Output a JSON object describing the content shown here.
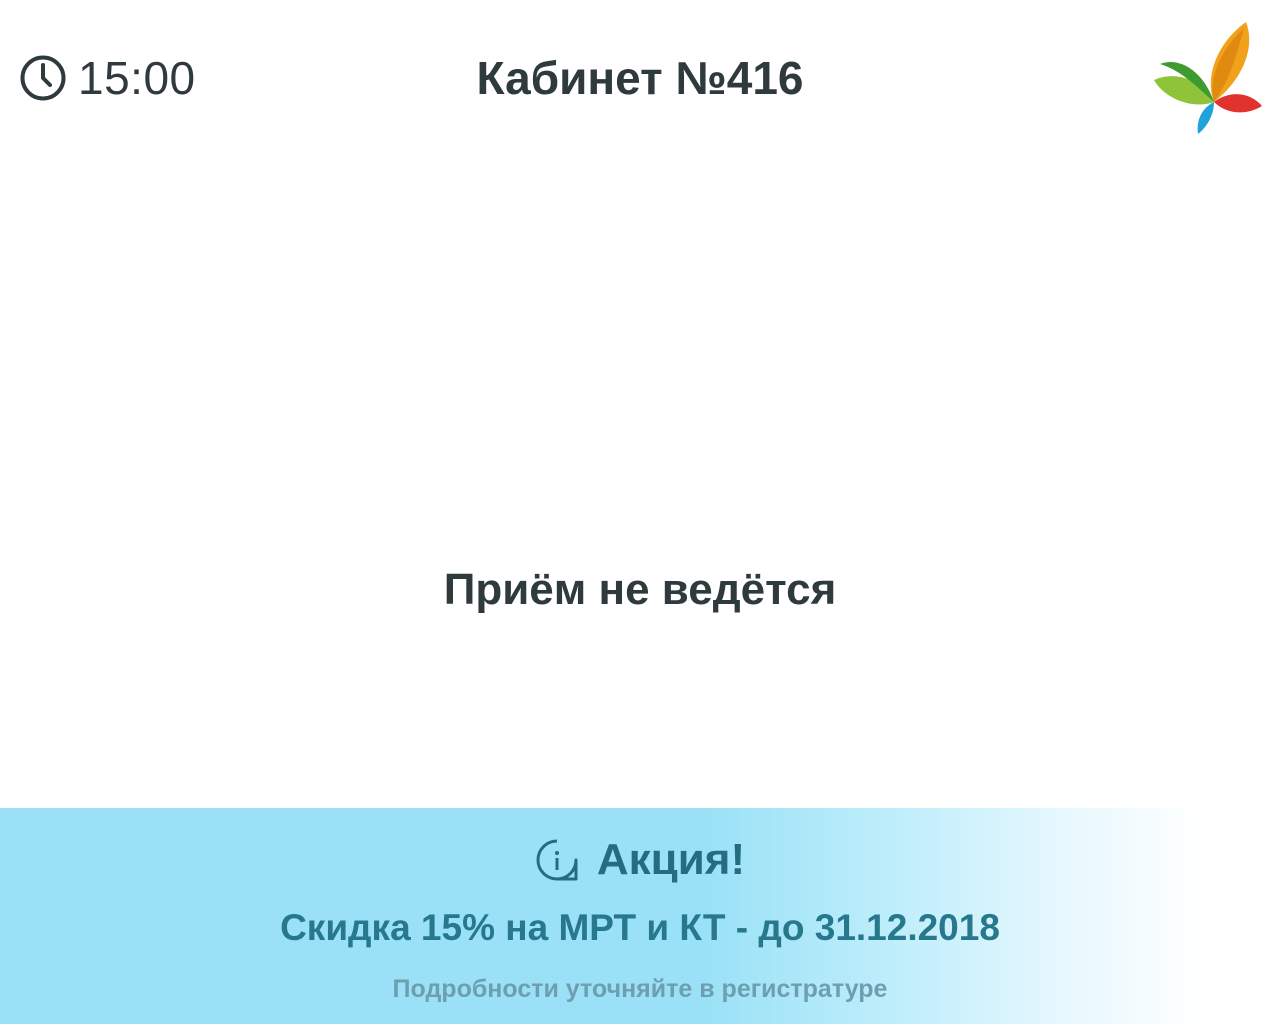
{
  "header": {
    "time": "15:00",
    "clock_icon": "clock-icon",
    "room_title": "Кабинет №416",
    "logo_icon": "clinic-logo-leaves"
  },
  "main": {
    "status_text": "Приём не ведётся"
  },
  "promo": {
    "info_icon": "info-icon",
    "title": "Акция!",
    "text": "Скидка 15% на МРТ и КТ - до 31.12.2018",
    "note": "Подробности уточняйте в регистратуре"
  },
  "colors": {
    "text": "#2f3a3d",
    "promo_background": "#9ae1f7",
    "promo_title": "#246d80",
    "promo_text": "#27788d",
    "promo_note": "#6e9fb0",
    "logo_orange": "#f0a21a",
    "logo_green": "#5fb53f",
    "logo_red": "#e2322d",
    "logo_blue": "#1fa3d8"
  }
}
